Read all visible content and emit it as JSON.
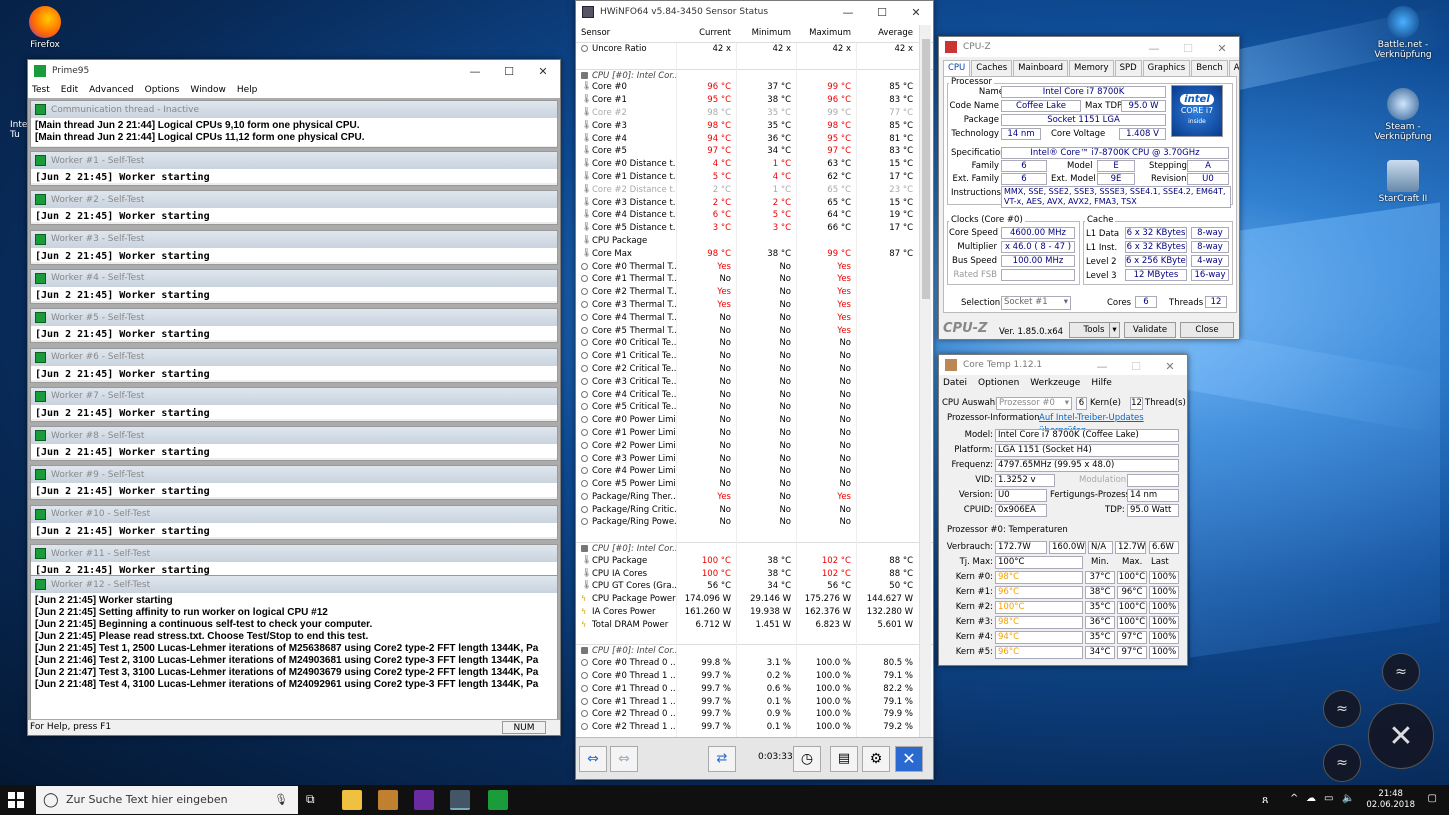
{
  "desktop": {
    "icons": [
      {
        "label": "Firefox"
      },
      {
        "label": "Battle.net - Verknüpfung"
      },
      {
        "label": "Steam - Verknüpfung"
      },
      {
        "label": "StarCraft II"
      }
    ],
    "clipped_left": "Inte\nTu"
  },
  "prime95": {
    "title": "Prime95",
    "menu": [
      "Test",
      "Edit",
      "Advanced",
      "Options",
      "Window",
      "Help"
    ],
    "comm": {
      "title": "Communication thread - Inactive",
      "lines": [
        "[Main thread Jun 2 21:44] Logical CPUs 9,10 form one physical CPU.",
        "[Main thread Jun 2 21:44] Logical CPUs 11,12 form one physical CPU."
      ]
    },
    "workers": [
      {
        "title": "Worker #1 - Self-Test",
        "line": "[Jun 2 21:45] Worker starting"
      },
      {
        "title": "Worker #2 - Self-Test",
        "line": "[Jun 2 21:45] Worker starting"
      },
      {
        "title": "Worker #3 - Self-Test",
        "line": "[Jun 2 21:45] Worker starting"
      },
      {
        "title": "Worker #4 - Self-Test",
        "line": "[Jun 2 21:45] Worker starting"
      },
      {
        "title": "Worker #5 - Self-Test",
        "line": "[Jun 2 21:45] Worker starting"
      },
      {
        "title": "Worker #6 - Self-Test",
        "line": "[Jun 2 21:45] Worker starting"
      },
      {
        "title": "Worker #7 - Self-Test",
        "line": "[Jun 2 21:45] Worker starting"
      },
      {
        "title": "Worker #8 - Self-Test",
        "line": "[Jun 2 21:45] Worker starting"
      },
      {
        "title": "Worker #9 - Self-Test",
        "line": "[Jun 2 21:45] Worker starting"
      },
      {
        "title": "Worker #10 - Self-Test",
        "line": "[Jun 2 21:45] Worker starting"
      },
      {
        "title": "Worker #11 - Self-Test",
        "line": "[Jun 2 21:45] Worker starting"
      }
    ],
    "worker12": {
      "title": "Worker #12 - Self-Test",
      "lines": [
        "[Jun 2 21:45] Worker starting",
        "[Jun 2 21:45] Setting affinity to run worker on logical CPU #12",
        "[Jun 2 21:45] Beginning a continuous self-test to check your computer.",
        "[Jun 2 21:45] Please read stress.txt.  Choose Test/Stop to end this test.",
        "[Jun 2 21:45] Test 1, 2500 Lucas-Lehmer iterations of M25638687 using Core2 type-2 FFT length 1344K, Pa",
        "[Jun 2 21:46] Test 2, 3100 Lucas-Lehmer iterations of M24903681 using Core2 type-3 FFT length 1344K, Pa",
        "[Jun 2 21:47] Test 3, 3100 Lucas-Lehmer iterations of M24903679 using Core2 type-2 FFT length 1344K, Pa",
        "[Jun 2 21:48] Test 4, 3100 Lucas-Lehmer iterations of M24092961 using Core2 type-3 FFT length 1344K, Pa"
      ]
    },
    "status": "For Help, press F1",
    "num": "NUM"
  },
  "hwinfo": {
    "title": "HWiNFO64 v5.84-3450 Sensor Status",
    "headers": [
      "Sensor",
      "Current",
      "Minimum",
      "Maximum",
      "Average"
    ],
    "rows": [
      {
        "n": "Uncore Ratio",
        "c": "42 x",
        "mi": "42 x",
        "ma": "42 x",
        "a": "42 x",
        "ico": "o"
      },
      {
        "n": "",
        "c": "",
        "mi": "",
        "ma": "",
        "a": ""
      },
      {
        "n": "CPU [#0]: Intel Cor...",
        "c": "",
        "mi": "",
        "ma": "",
        "a": "",
        "g": 1
      },
      {
        "n": "Core #0",
        "c": "96 °C",
        "mi": "37 °C",
        "ma": "99 °C",
        "a": "85 °C",
        "cr": 1,
        "mar": 1
      },
      {
        "n": "Core #1",
        "c": "95 °C",
        "mi": "38 °C",
        "ma": "96 °C",
        "a": "83 °C",
        "cr": 1,
        "mar": 1
      },
      {
        "n": "Core #2",
        "c": "98 °C",
        "mi": "35 °C",
        "ma": "99 °C",
        "a": "77 °C",
        "gr": 1
      },
      {
        "n": "Core #3",
        "c": "98 °C",
        "mi": "35 °C",
        "ma": "98 °C",
        "a": "85 °C",
        "cr": 1,
        "mar": 1
      },
      {
        "n": "Core #4",
        "c": "94 °C",
        "mi": "36 °C",
        "ma": "95 °C",
        "a": "81 °C",
        "cr": 1,
        "mar": 1
      },
      {
        "n": "Core #5",
        "c": "97 °C",
        "mi": "34 °C",
        "ma": "97 °C",
        "a": "83 °C",
        "cr": 1,
        "mar": 1
      },
      {
        "n": "Core #0 Distance t...",
        "c": "4 °C",
        "mi": "1 °C",
        "ma": "63 °C",
        "a": "15 °C",
        "cr": 1,
        "mir": 1
      },
      {
        "n": "Core #1 Distance t...",
        "c": "5 °C",
        "mi": "4 °C",
        "ma": "62 °C",
        "a": "17 °C",
        "cr": 1,
        "mir": 1
      },
      {
        "n": "Core #2 Distance t...",
        "c": "2 °C",
        "mi": "1 °C",
        "ma": "65 °C",
        "a": "23 °C",
        "gr": 1
      },
      {
        "n": "Core #3 Distance t...",
        "c": "2 °C",
        "mi": "2 °C",
        "ma": "65 °C",
        "a": "15 °C",
        "cr": 1,
        "mir": 1
      },
      {
        "n": "Core #4 Distance t...",
        "c": "6 °C",
        "mi": "5 °C",
        "ma": "64 °C",
        "a": "19 °C",
        "cr": 1,
        "mir": 1
      },
      {
        "n": "Core #5 Distance t...",
        "c": "3 °C",
        "mi": "3 °C",
        "ma": "66 °C",
        "a": "17 °C",
        "cr": 1,
        "mir": 1
      },
      {
        "n": "CPU Package",
        "c": "",
        "mi": "",
        "ma": "",
        "a": ""
      },
      {
        "n": "Core Max",
        "c": "98 °C",
        "mi": "38 °C",
        "ma": "99 °C",
        "a": "87 °C",
        "cr": 1,
        "mar": 1
      },
      {
        "n": "Core #0 Thermal T...",
        "c": "Yes",
        "mi": "No",
        "ma": "Yes",
        "a": "",
        "cr": 1,
        "mar": 1,
        "ico": "o"
      },
      {
        "n": "Core #1 Thermal T...",
        "c": "No",
        "mi": "No",
        "ma": "Yes",
        "a": "",
        "mar": 1,
        "ico": "o"
      },
      {
        "n": "Core #2 Thermal T...",
        "c": "Yes",
        "mi": "No",
        "ma": "Yes",
        "a": "",
        "cr": 1,
        "mar": 1,
        "ico": "o"
      },
      {
        "n": "Core #3 Thermal T...",
        "c": "Yes",
        "mi": "No",
        "ma": "Yes",
        "a": "",
        "cr": 1,
        "mar": 1,
        "ico": "o"
      },
      {
        "n": "Core #4 Thermal T...",
        "c": "No",
        "mi": "No",
        "ma": "Yes",
        "a": "",
        "mar": 1,
        "ico": "o"
      },
      {
        "n": "Core #5 Thermal T...",
        "c": "No",
        "mi": "No",
        "ma": "Yes",
        "a": "",
        "mar": 1,
        "ico": "o"
      },
      {
        "n": "Core #0 Critical Te...",
        "c": "No",
        "mi": "No",
        "ma": "No",
        "a": "",
        "ico": "o"
      },
      {
        "n": "Core #1 Critical Te...",
        "c": "No",
        "mi": "No",
        "ma": "No",
        "a": "",
        "ico": "o"
      },
      {
        "n": "Core #2 Critical Te...",
        "c": "No",
        "mi": "No",
        "ma": "No",
        "a": "",
        "ico": "o"
      },
      {
        "n": "Core #3 Critical Te...",
        "c": "No",
        "mi": "No",
        "ma": "No",
        "a": "",
        "ico": "o"
      },
      {
        "n": "Core #4 Critical Te...",
        "c": "No",
        "mi": "No",
        "ma": "No",
        "a": "",
        "ico": "o"
      },
      {
        "n": "Core #5 Critical Te...",
        "c": "No",
        "mi": "No",
        "ma": "No",
        "a": "",
        "ico": "o"
      },
      {
        "n": "Core #0 Power Limi...",
        "c": "No",
        "mi": "No",
        "ma": "No",
        "a": "",
        "ico": "o"
      },
      {
        "n": "Core #1 Power Limi...",
        "c": "No",
        "mi": "No",
        "ma": "No",
        "a": "",
        "ico": "o"
      },
      {
        "n": "Core #2 Power Limi...",
        "c": "No",
        "mi": "No",
        "ma": "No",
        "a": "",
        "ico": "o"
      },
      {
        "n": "Core #3 Power Limi...",
        "c": "No",
        "mi": "No",
        "ma": "No",
        "a": "",
        "ico": "o"
      },
      {
        "n": "Core #4 Power Limi...",
        "c": "No",
        "mi": "No",
        "ma": "No",
        "a": "",
        "ico": "o"
      },
      {
        "n": "Core #5 Power Limi...",
        "c": "No",
        "mi": "No",
        "ma": "No",
        "a": "",
        "ico": "o"
      },
      {
        "n": "Package/Ring Ther...",
        "c": "Yes",
        "mi": "No",
        "ma": "Yes",
        "a": "",
        "cr": 1,
        "mar": 1,
        "ico": "o"
      },
      {
        "n": "Package/Ring Critic...",
        "c": "No",
        "mi": "No",
        "ma": "No",
        "a": "",
        "ico": "o"
      },
      {
        "n": "Package/Ring Powe...",
        "c": "No",
        "mi": "No",
        "ma": "No",
        "a": "",
        "ico": "o"
      },
      {
        "n": "",
        "c": "",
        "mi": "",
        "ma": "",
        "a": ""
      },
      {
        "n": "CPU [#0]: Intel Cor...",
        "c": "",
        "mi": "",
        "ma": "",
        "a": "",
        "g": 1
      },
      {
        "n": "CPU Package",
        "c": "100 °C",
        "mi": "38 °C",
        "ma": "102 °C",
        "a": "88 °C",
        "cr": 1,
        "mar": 1
      },
      {
        "n": "CPU IA Cores",
        "c": "100 °C",
        "mi": "38 °C",
        "ma": "102 °C",
        "a": "88 °C",
        "cr": 1,
        "mar": 1
      },
      {
        "n": "CPU GT Cores (Gra...",
        "c": "56 °C",
        "mi": "34 °C",
        "ma": "56 °C",
        "a": "50 °C"
      },
      {
        "n": "CPU Package Power",
        "c": "174.096 W",
        "mi": "29.146 W",
        "ma": "175.276 W",
        "a": "144.627 W",
        "ico": "p"
      },
      {
        "n": "IA Cores Power",
        "c": "161.260 W",
        "mi": "19.938 W",
        "ma": "162.376 W",
        "a": "132.280 W",
        "ico": "p"
      },
      {
        "n": "Total DRAM Power",
        "c": "6.712 W",
        "mi": "1.451 W",
        "ma": "6.823 W",
        "a": "5.601 W",
        "ico": "p"
      },
      {
        "n": "",
        "c": "",
        "mi": "",
        "ma": "",
        "a": ""
      },
      {
        "n": "CPU [#0]: Intel Cor...",
        "c": "",
        "mi": "",
        "ma": "",
        "a": "",
        "g": 1
      },
      {
        "n": "Core #0 Thread 0 ...",
        "c": "99.8 %",
        "mi": "3.1 %",
        "ma": "100.0 %",
        "a": "80.5 %",
        "ico": "o"
      },
      {
        "n": "Core #0 Thread 1 ...",
        "c": "99.7 %",
        "mi": "0.2 %",
        "ma": "100.0 %",
        "a": "79.1 %",
        "ico": "o"
      },
      {
        "n": "Core #1 Thread 0 ...",
        "c": "99.7 %",
        "mi": "0.6 %",
        "ma": "100.0 %",
        "a": "82.2 %",
        "ico": "o"
      },
      {
        "n": "Core #1 Thread 1 ...",
        "c": "99.7 %",
        "mi": "0.1 %",
        "ma": "100.0 %",
        "a": "79.1 %",
        "ico": "o"
      },
      {
        "n": "Core #2 Thread 0 ...",
        "c": "99.7 %",
        "mi": "0.9 %",
        "ma": "100.0 %",
        "a": "79.9 %",
        "ico": "o"
      },
      {
        "n": "Core #2 Thread 1 ...",
        "c": "99.7 %",
        "mi": "0.1 %",
        "ma": "100.0 %",
        "a": "79.2 %",
        "ico": "o"
      }
    ],
    "timer": "0:03:33"
  },
  "cpuz": {
    "title": "CPU-Z",
    "tabs": [
      "CPU",
      "Caches",
      "Mainboard",
      "Memory",
      "SPD",
      "Graphics",
      "Bench",
      "About"
    ],
    "processor": "Processor",
    "name_l": "Name",
    "name": "Intel Core i7 8700K",
    "codename_l": "Code Name",
    "codename": "Coffee Lake",
    "tdp_l": "Max TDP",
    "tdp": "95.0 W",
    "package_l": "Package",
    "package": "Socket 1151 LGA",
    "tech_l": "Technology",
    "tech": "14 nm",
    "cv_l": "Core Voltage",
    "cv": "1.408 V",
    "spec_l": "Specification",
    "spec": "Intel® Core™ i7-8700K CPU @ 3.70GHz",
    "family_l": "Family",
    "family": "6",
    "model_l": "Model",
    "model": "E",
    "stepping_l": "Stepping",
    "stepping": "A",
    "extfam_l": "Ext. Family",
    "extfam": "6",
    "extmod_l": "Ext. Model",
    "extmod": "9E",
    "rev_l": "Revision",
    "rev": "U0",
    "instr_l": "Instructions",
    "instr": "MMX, SSE, SSE2, SSE3, SSSE3, SSE4.1, SSE4.2, EM64T, VT-x, AES, AVX, AVX2, FMA3, TSX",
    "clocks": "Clocks (Core #0)",
    "cs_l": "Core Speed",
    "cs": "4600.00 MHz",
    "mult_l": "Multiplier",
    "mult": "x 46.0 ( 8 - 47 )",
    "bus_l": "Bus Speed",
    "bus": "100.00 MHz",
    "fsb_l": "Rated FSB",
    "cache": "Cache",
    "l1d_l": "L1 Data",
    "l1d": "6 x 32 KBytes",
    "l1d_w": "8-way",
    "l1i_l": "L1 Inst.",
    "l1i": "6 x 32 KBytes",
    "l1i_w": "8-way",
    "l2_l": "Level 2",
    "l2": "6 x 256 KBytes",
    "l2_w": "4-way",
    "l3_l": "Level 3",
    "l3": "12 MBytes",
    "l3_w": "16-way",
    "sel_l": "Selection",
    "sel": "Socket #1",
    "cores_l": "Cores",
    "cores": "6",
    "threads_l": "Threads",
    "threads": "12",
    "brand": "CPU-Z",
    "ver": "Ver. 1.85.0.x64",
    "tools": "Tools",
    "validate": "Validate",
    "close": "Close",
    "logo1": "intel",
    "logo2": "CORE i7",
    "logo3": "inside"
  },
  "coretemp": {
    "title": "Core Temp 1.12.1",
    "menu": [
      "Datei",
      "Optionen",
      "Werkzeuge",
      "Hilfe"
    ],
    "cpu_l": "CPU Auswahl:",
    "cpu": "Prozessor #0",
    "kern": "6",
    "kern_l": "Kern(e)",
    "thr": "12",
    "thr_l": "Thread(s)",
    "info_l": "Prozessor-Information",
    "link": "Auf Intel-Treiber-Updates überprüfen",
    "model_l": "Model:",
    "model": "Intel Core i7 8700K (Coffee Lake)",
    "plat_l": "Platform:",
    "plat": "LGA 1151 (Socket H4)",
    "freq_l": "Frequenz:",
    "freq": "4797.65MHz (99.95 x 48.0)",
    "vid_l": "VID:",
    "vid": "1.3252 v",
    "mod_l": "Modulation:",
    "ver_l": "Version:",
    "ver": "U0",
    "fp_l": "Fertigungs-Prozess:",
    "fp": "14 nm",
    "cpuid_l": "CPUID:",
    "cpuid": "0x906EA",
    "tdp_l": "TDP:",
    "tdp": "95.0 Watt",
    "temps_l": "Prozessor #0: Temperaturen",
    "verb_l": "Verbrauch:",
    "verb": [
      "172.7W",
      "160.0W",
      "N/A",
      "12.7W",
      "6.6W"
    ],
    "tj_l": "Tj. Max:",
    "tj": "100°C",
    "min_l": "Min.",
    "max_l": "Max.",
    "last_l": "Last",
    "cores": [
      {
        "l": "Kern #0:",
        "t": "98°C",
        "mi": "37°C",
        "ma": "100°C",
        "ld": "100%"
      },
      {
        "l": "Kern #1:",
        "t": "96°C",
        "mi": "38°C",
        "ma": "96°C",
        "ld": "100%"
      },
      {
        "l": "Kern #2:",
        "t": "100°C",
        "mi": "35°C",
        "ma": "100°C",
        "ld": "100%"
      },
      {
        "l": "Kern #3:",
        "t": "98°C",
        "mi": "36°C",
        "ma": "100°C",
        "ld": "100%"
      },
      {
        "l": "Kern #4:",
        "t": "94°C",
        "mi": "35°C",
        "ma": "97°C",
        "ld": "100%"
      },
      {
        "l": "Kern #5:",
        "t": "96°C",
        "mi": "34°C",
        "ma": "97°C",
        "ld": "100%"
      }
    ]
  },
  "taskbar": {
    "search": "Zur Suche Text hier eingeben",
    "time": "21:48",
    "date": "02.06.2018"
  }
}
